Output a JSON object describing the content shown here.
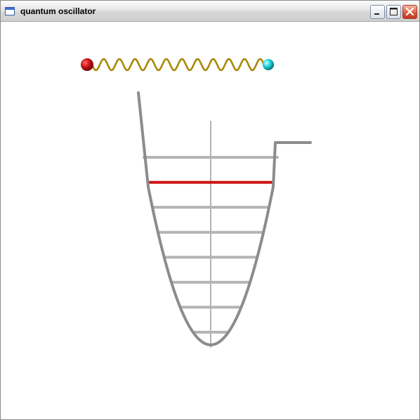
{
  "window": {
    "title": "quantum oscillator",
    "icon": "window-app-icon",
    "controls": [
      "minimize-icon",
      "maximize-icon",
      "close-icon"
    ]
  },
  "scene": {
    "spring": {
      "left_ball_color": "#c01010",
      "right_ball_color": "#10c8d0",
      "coil_color": "#a8880a",
      "coils": 11
    },
    "potential_well": {
      "curve_color": "#8c8c8c",
      "axis_color": "#808080",
      "level_color": "#b4b4b4",
      "highlight_color": "#cc1010",
      "energy_levels": 8,
      "highlighted_level": 7
    }
  }
}
